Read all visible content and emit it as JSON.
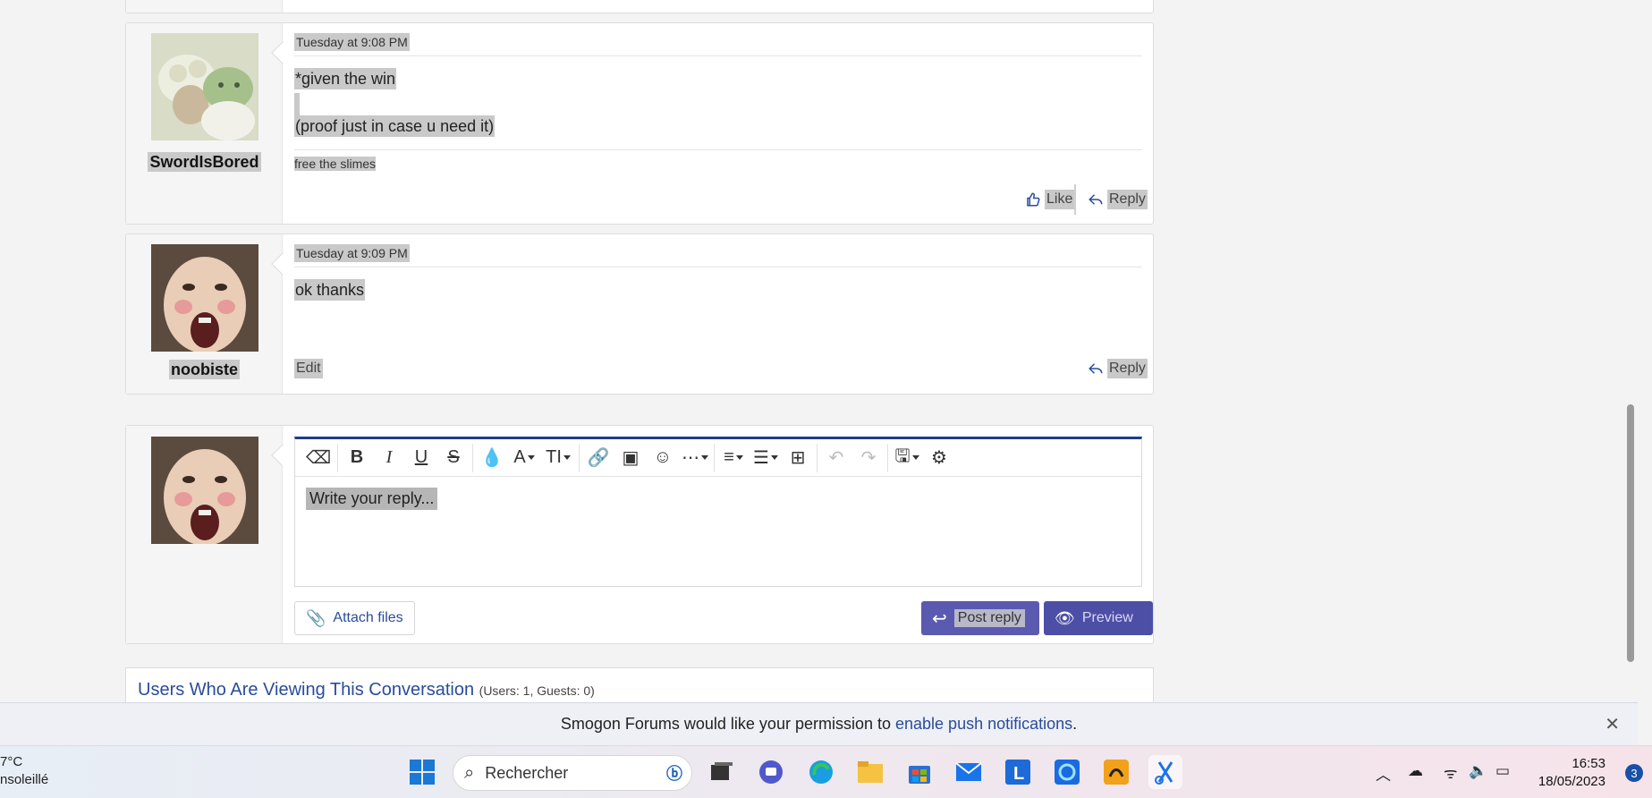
{
  "messages": [
    {
      "username": "SwordIsBored",
      "date": "Tuesday at 9:08 PM",
      "lines": [
        "*given the win",
        "(proof just in case u need it)"
      ],
      "signature": "free the slimes",
      "like_label": "Like",
      "reply_label": "Reply"
    },
    {
      "username": "noobiste",
      "date": "Tuesday at 9:09 PM",
      "lines": [
        "ok thanks"
      ],
      "edit_label": "Edit",
      "reply_label": "Reply"
    }
  ],
  "reply_box": {
    "placeholder": "Write your reply...",
    "attach_label": "Attach files",
    "post_label": "Post reply",
    "preview_label": "Preview",
    "toolbar_icons": [
      "eraser-icon",
      "bold-icon",
      "italic-icon",
      "underline-icon",
      "strikethrough-icon",
      "color-icon",
      "font-icon",
      "font-size-icon",
      "link-icon",
      "image-icon",
      "emoji-icon",
      "more-icon",
      "align-icon",
      "list-icon",
      "table-icon",
      "undo-icon",
      "redo-icon",
      "drafts-icon",
      "settings-icon"
    ]
  },
  "viewers": {
    "title": "Users Who Are Viewing This Conversation",
    "count": "(Users: 1, Guests: 0)"
  },
  "notification": {
    "text": "Smogon Forums would like your permission to",
    "link": "enable push notifications",
    "suffix": ".",
    "close": "✕"
  },
  "taskbar": {
    "temp": "7°C",
    "weather": "nsoleillé",
    "search_placeholder": "Rechercher",
    "time": "16:53",
    "date": "18/05/2023",
    "badge": "3"
  },
  "colors": {
    "accent": "#2a4c9a",
    "button": "#5a5ab0",
    "editor_top": "#1f3d8c"
  }
}
